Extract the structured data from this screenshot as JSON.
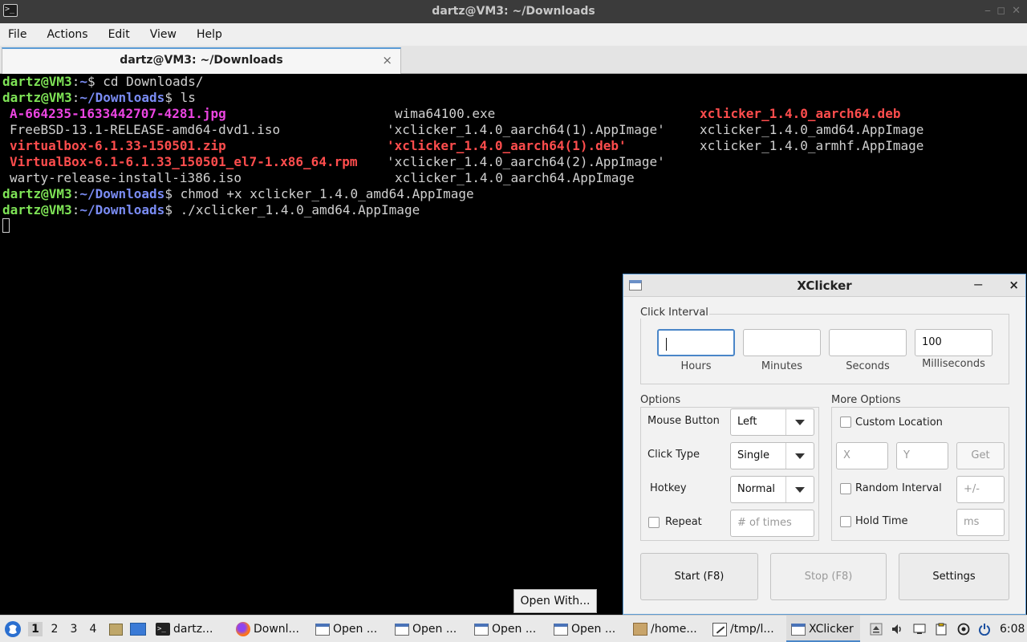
{
  "terminal_window": {
    "title": "dartz@VM3: ~/Downloads",
    "menu": [
      "File",
      "Actions",
      "Edit",
      "View",
      "Help"
    ],
    "tab_label": "dartz@VM3: ~/Downloads",
    "tab_close": "×",
    "prompt_user": "dartz@VM3",
    "prompt_sep": ":",
    "home_path": "~",
    "downloads_path": "~/Downloads",
    "prompt_end": "$",
    "cmd1": " cd Downloads/",
    "cmd2": " ls",
    "cmd3": " chmod +x xclicker_1.4.0_amd64.AppImage",
    "cmd4": " ./xclicker_1.4.0_amd64.AppImage",
    "ls_col1": [
      "A-664235-1633442707-4281.jpg",
      "FreeBSD-13.1-RELEASE-amd64-dvd1.iso",
      "virtualbox-6.1.33-150501.zip",
      "VirtualBox-6.1-6.1.33_150501_el7-1.x86_64.rpm",
      "warty-release-install-i386.iso"
    ],
    "ls_col2": [
      "wima64100.exe",
      "'xclicker_1.4.0_aarch64(1).AppImage'",
      "'xclicker_1.4.0_aarch64(1).deb'",
      "'xclicker_1.4.0_aarch64(2).AppImage'",
      "xclicker_1.4.0_aarch64.AppImage"
    ],
    "ls_col3": [
      "xclicker_1.4.0_aarch64.deb",
      "xclicker_1.4.0_amd64.AppImage",
      "xclicker_1.4.0_armhf.AppImage"
    ]
  },
  "tooltip": {
    "label": "Open With..."
  },
  "xclicker": {
    "title": "XClicker",
    "minimize": "−",
    "close": "×",
    "click_interval": {
      "label": "Click Interval",
      "hours_value": "",
      "minutes_value": "",
      "seconds_value": "",
      "milliseconds_value": "100",
      "hours_label": "Hours",
      "minutes_label": "Minutes",
      "seconds_label": "Seconds",
      "milliseconds_label": "Milliseconds"
    },
    "options": {
      "label": "Options",
      "mouse_button_label": "Mouse Button",
      "mouse_button_value": "Left",
      "click_type_label": "Click Type",
      "click_type_value": "Single",
      "hotkey_label": "Hotkey",
      "hotkey_value": "Normal",
      "repeat_label": "Repeat",
      "repeat_checked": false,
      "times_placeholder": "# of times"
    },
    "more_options": {
      "label": "More Options",
      "custom_location_label": "Custom Location",
      "x_placeholder": "X",
      "y_placeholder": "Y",
      "get_label": "Get",
      "random_interval_label": "Random Interval",
      "random_placeholder": "+/-",
      "hold_time_label": "Hold Time",
      "hold_placeholder": "ms"
    },
    "buttons": {
      "start": "Start (F8)",
      "stop": "Stop (F8)",
      "settings": "Settings"
    }
  },
  "taskbar": {
    "workspaces": [
      "1",
      "2",
      "3",
      "4"
    ],
    "active_workspace": "1",
    "tasks": [
      {
        "label": "dartz...",
        "icon": "terminal-icon"
      },
      {
        "label": "Downl...",
        "icon": "firefox-icon"
      },
      {
        "label": "Open ...",
        "icon": "window-icon"
      },
      {
        "label": "Open ...",
        "icon": "window-icon"
      },
      {
        "label": "Open ...",
        "icon": "window-icon"
      },
      {
        "label": "Open ...",
        "icon": "window-icon"
      },
      {
        "label": "/home...",
        "icon": "archive-icon"
      },
      {
        "label": "/tmp/l...",
        "icon": "text-editor-icon"
      },
      {
        "label": "XClicker",
        "icon": "window-icon"
      }
    ],
    "clock": "6:08"
  }
}
